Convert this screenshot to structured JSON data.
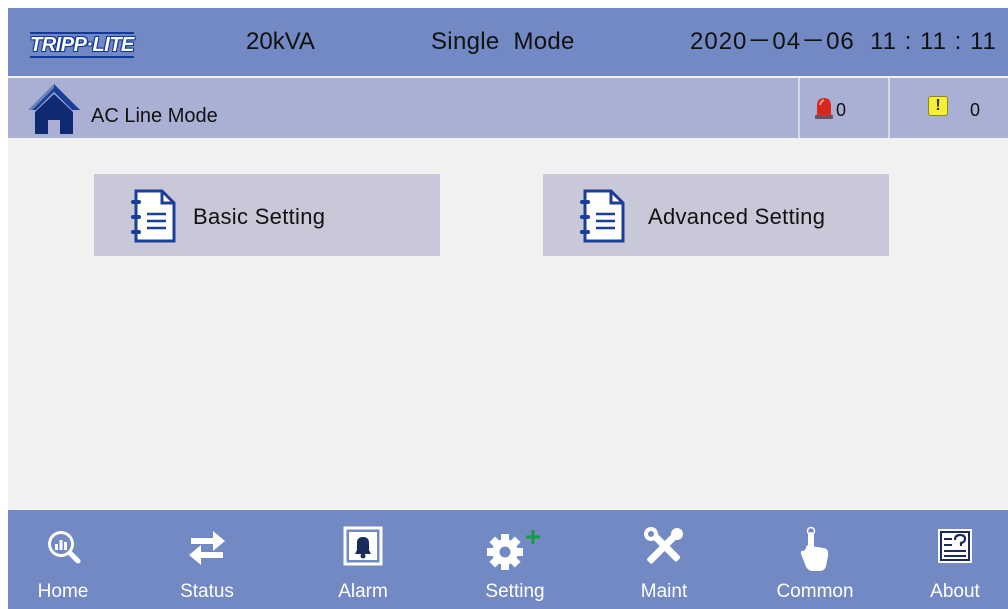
{
  "header": {
    "logo_text": "TRIPP·LITE",
    "capacity": "20kVA",
    "mode": "Single  Mode",
    "datetime": "2020－04－06  11 : 11 : 11"
  },
  "status": {
    "line_mode": "AC Line Mode",
    "alarm_count": "0",
    "warning_symbol": "!",
    "warning_count": "0"
  },
  "menu": {
    "basic_label": "Basic Setting",
    "advanced_label": "Advanced Setting"
  },
  "nav": {
    "items": [
      {
        "label": "Home",
        "icon": "magnifier-chart-icon"
      },
      {
        "label": "Status",
        "icon": "swap-arrows-icon"
      },
      {
        "label": "Alarm",
        "icon": "bell-icon"
      },
      {
        "label": "Setting",
        "icon": "gear-plus-icon"
      },
      {
        "label": "Maint",
        "icon": "tools-icon"
      },
      {
        "label": "Common",
        "icon": "hand-pointer-icon"
      },
      {
        "label": "About",
        "icon": "help-document-icon"
      }
    ]
  },
  "colors": {
    "header_bg": "#7289c4",
    "status_bg": "#a9b0d4",
    "button_bg": "#c9c8d8",
    "content_bg": "#f1f1f1",
    "logo_blue": "#13389b",
    "plus_green": "#1a9c3c"
  }
}
